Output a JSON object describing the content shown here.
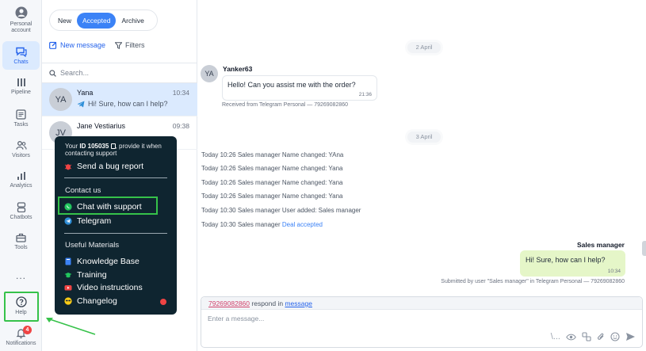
{
  "rail": {
    "items": [
      {
        "key": "account",
        "label": "Personal account",
        "icon": "user-circle-icon"
      },
      {
        "key": "chats",
        "label": "Chats",
        "icon": "chat-icon"
      },
      {
        "key": "pipeline",
        "label": "Pipeline",
        "icon": "pipeline-icon"
      },
      {
        "key": "tasks",
        "label": "Tasks",
        "icon": "tasks-icon"
      },
      {
        "key": "visitors",
        "label": "Visitors",
        "icon": "visitors-icon"
      },
      {
        "key": "analytics",
        "label": "Analytics",
        "icon": "analytics-icon"
      },
      {
        "key": "chatbots",
        "label": "Chatbots",
        "icon": "chatbot-icon"
      },
      {
        "key": "tools",
        "label": "Tools",
        "icon": "toolbox-icon"
      },
      {
        "key": "more",
        "label": "...",
        "icon": "more-icon"
      },
      {
        "key": "help",
        "label": "Help",
        "icon": "help-icon"
      },
      {
        "key": "notifications",
        "label": "Notifications",
        "icon": "bell-icon",
        "badge": "4"
      }
    ],
    "active": "chats",
    "accent": "#2563eb"
  },
  "tabs": {
    "items": [
      "New",
      "Accepted",
      "Archive"
    ],
    "active": "Accepted"
  },
  "toolbar": {
    "new_message": "New message",
    "filters": "Filters"
  },
  "search": {
    "placeholder": "Search..."
  },
  "conversations": [
    {
      "initials": "YA",
      "name": "Yana",
      "time": "10:34",
      "preview": "Hi! Sure, how can I help?",
      "channel": "telegram"
    },
    {
      "initials": "JV",
      "name": "Jane Vestiarius",
      "time": "09:38",
      "preview": "",
      "channel": "telegram"
    }
  ],
  "chat": {
    "date1": "2 April",
    "incoming": {
      "initials": "YA",
      "author": "Yanker63",
      "text": "Hello! Can you assist me with the order?",
      "time": "21:36",
      "meta": "Received from Telegram Personal — 79269082860"
    },
    "date2": "3 April",
    "logs": [
      {
        "text": "Today 10:26 Sales manager Name changed: YAna",
        "link": ""
      },
      {
        "text": "Today 10:26 Sales manager Name changed: Yana",
        "link": ""
      },
      {
        "text": "Today 10:26 Sales manager Name changed: Yana",
        "link": ""
      },
      {
        "text": "Today 10:26 Sales manager Name changed: Yana",
        "link": ""
      },
      {
        "text": "Today 10:30 Sales manager User added: Sales manager",
        "link": ""
      },
      {
        "text": "Today 10:30 Sales manager",
        "link": "Deal accepted"
      }
    ],
    "outgoing": {
      "author": "Sales manager",
      "text": "Hi! Sure, how can I help?",
      "time": "10:34",
      "meta": "Submitted by user \"Sales manager\" in Telegram Personal — 79269082860"
    }
  },
  "composer": {
    "phone": "79269082860",
    "respond_in": "respond in",
    "channel_word": "message",
    "placeholder": "Enter a message...",
    "slash": "\\..."
  },
  "popup": {
    "id_prefix": "Your",
    "id_label": "ID 105035",
    "id_suffix": ", provide it when contacting support",
    "bug": "Send a bug report",
    "contact_title": "Contact us",
    "chat_support": "Chat with support",
    "telegram": "Telegram",
    "materials_title": "Useful Materials",
    "knowledge": "Knowledge Base",
    "training": "Training",
    "video": "Video instructions",
    "changelog": "Changelog"
  }
}
